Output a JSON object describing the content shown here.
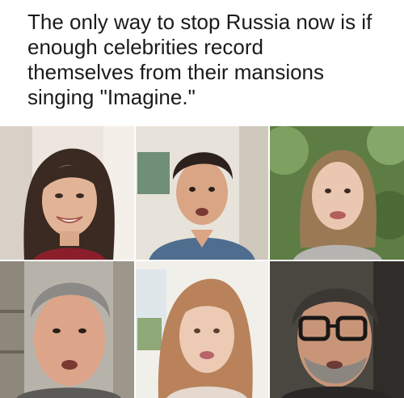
{
  "caption": {
    "line1": "The only way to stop Russia now is if",
    "line2": "enough celebrities record",
    "line3": "themselves from their mansions",
    "line4": "singing \"Imagine.\""
  },
  "colors": {
    "background": "#ffffff",
    "caption_text": "#1b1b1b"
  }
}
